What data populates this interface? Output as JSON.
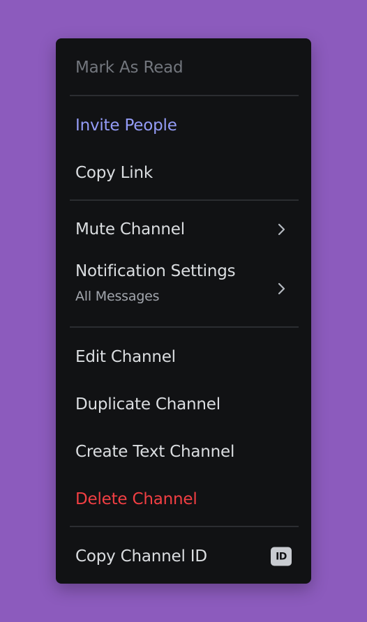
{
  "colors": {
    "background": "#8c5bbd",
    "menu_bg": "#111214",
    "separator": "#2b2d31",
    "text_default": "#dbdee1",
    "text_muted": "#72767d",
    "text_sub": "#a2a6ad",
    "text_accent": "#949cf7",
    "text_danger": "#f23f43"
  },
  "menu": {
    "mark_as_read": "Mark As Read",
    "invite_people": "Invite People",
    "copy_link": "Copy Link",
    "mute_channel": "Mute Channel",
    "notification_settings": "Notification Settings",
    "notification_settings_value": "All Messages",
    "edit_channel": "Edit Channel",
    "duplicate_channel": "Duplicate Channel",
    "create_text_channel": "Create Text Channel",
    "delete_channel": "Delete Channel",
    "copy_channel_id": "Copy Channel ID",
    "id_badge": "ID"
  },
  "icons": {
    "submenu_arrow": "chevron-right-icon",
    "id": "id-badge-icon"
  }
}
